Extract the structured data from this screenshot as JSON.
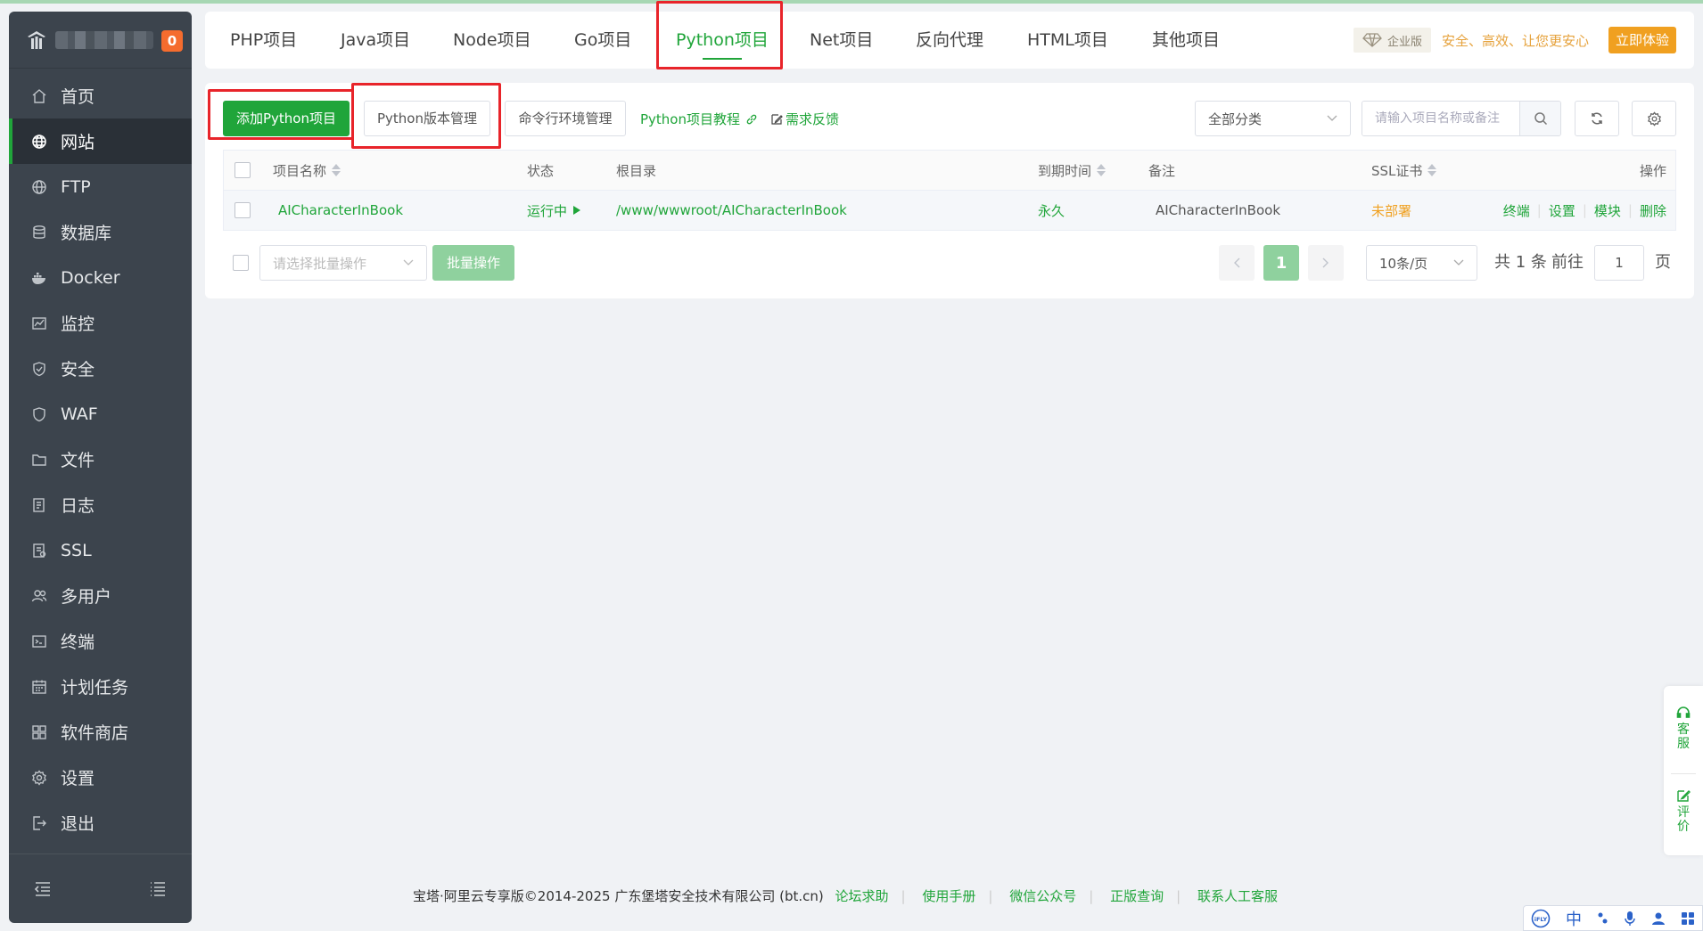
{
  "sidebar": {
    "badge": "0",
    "items": [
      {
        "label": "首页",
        "icon": "home-icon",
        "active": false
      },
      {
        "label": "网站",
        "icon": "globe-icon",
        "active": true
      },
      {
        "label": "FTP",
        "icon": "ftp-icon",
        "active": false
      },
      {
        "label": "数据库",
        "icon": "database-icon",
        "active": false
      },
      {
        "label": "Docker",
        "icon": "docker-icon",
        "active": false
      },
      {
        "label": "监控",
        "icon": "monitor-icon",
        "active": false
      },
      {
        "label": "安全",
        "icon": "shield-icon",
        "active": false
      },
      {
        "label": "WAF",
        "icon": "waf-icon",
        "active": false
      },
      {
        "label": "文件",
        "icon": "folder-icon",
        "active": false
      },
      {
        "label": "日志",
        "icon": "log-icon",
        "active": false
      },
      {
        "label": "SSL",
        "icon": "ssl-icon",
        "active": false
      },
      {
        "label": "多用户",
        "icon": "users-icon",
        "active": false
      },
      {
        "label": "终端",
        "icon": "terminal-icon",
        "active": false
      },
      {
        "label": "计划任务",
        "icon": "calendar-icon",
        "active": false
      },
      {
        "label": "软件商店",
        "icon": "apps-icon",
        "active": false
      },
      {
        "label": "设置",
        "icon": "gear-icon",
        "active": false
      },
      {
        "label": "退出",
        "icon": "logout-icon",
        "active": false
      }
    ]
  },
  "tabs": [
    {
      "label": "PHP项目",
      "active": false
    },
    {
      "label": "Java项目",
      "active": false
    },
    {
      "label": "Node项目",
      "active": false
    },
    {
      "label": "Go项目",
      "active": false
    },
    {
      "label": "Python项目",
      "active": true
    },
    {
      "label": "Net项目",
      "active": false
    },
    {
      "label": "反向代理",
      "active": false
    },
    {
      "label": "HTML项目",
      "active": false
    },
    {
      "label": "其他项目",
      "active": false
    }
  ],
  "enterprise": {
    "badge": "企业版",
    "slogan": "安全、高效、让您更安心",
    "trial_button": "立即体验"
  },
  "toolbar": {
    "add_button": "添加Python项目",
    "version_button": "Python版本管理",
    "cli_button": "命令行环境管理",
    "tutorial_link": "Python项目教程",
    "feedback_link": "需求反馈",
    "category_select": "全部分类",
    "search_placeholder": "请输入项目名称或备注"
  },
  "table": {
    "headers": {
      "name": "项目名称",
      "status": "状态",
      "root": "根目录",
      "expire": "到期时间",
      "remark": "备注",
      "ssl": "SSL证书",
      "ops": "操作"
    },
    "rows": [
      {
        "name": "AICharacterInBook",
        "status": "运行中",
        "root": "/www/wwwroot/AICharacterInBook",
        "expire": "永久",
        "remark": "AICharacterInBook",
        "ssl": "未部署",
        "ops": [
          "终端",
          "设置",
          "模块",
          "删除"
        ]
      }
    ]
  },
  "footer_controls": {
    "batch_placeholder": "请选择批量操作",
    "batch_button": "批量操作",
    "current_page": "1",
    "page_size": "10条/页",
    "total_text": "共 1 条",
    "goto_label": "前往",
    "goto_value": "1",
    "page_unit": "页"
  },
  "floater": {
    "service": "客服",
    "review": "评价"
  },
  "page_footer": {
    "copyright": "宝塔·阿里云专享版©2014-2025 广东堡塔安全技术有限公司 (bt.cn)",
    "links": [
      "论坛求助",
      "使用手册",
      "微信公众号",
      "正版查询",
      "联系人工客服"
    ]
  },
  "ime": {
    "lang": "中"
  },
  "colors": {
    "brand": "#20a53a",
    "sidebar": "#3c444d",
    "highlight": "#e8242a",
    "warning": "#f0a020"
  }
}
